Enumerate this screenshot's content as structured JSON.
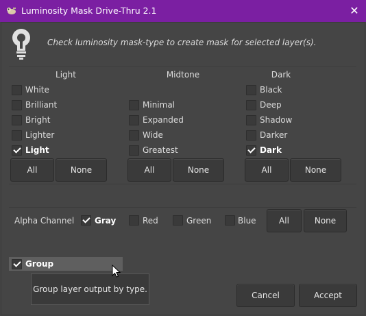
{
  "window": {
    "title": "Luminosity Mask Drive-Thru 2.1",
    "close_glyph": "✕",
    "app_icon": "gimp-wilber-icon"
  },
  "header": {
    "icon": "lightbulb-icon",
    "info_text": "Check luminosity mask-type to create mask for selected layer(s)."
  },
  "columns": {
    "light": {
      "heading": "Light",
      "items": [
        {
          "label": "White",
          "checked": false
        },
        {
          "label": "Brilliant",
          "checked": false
        },
        {
          "label": "Bright",
          "checked": false
        },
        {
          "label": "Lighter",
          "checked": false
        },
        {
          "label": "Light",
          "checked": true
        }
      ],
      "all_label": "All",
      "none_label": "None"
    },
    "midtone": {
      "heading": "Midtone",
      "items": [
        {
          "label": "Minimal",
          "checked": false
        },
        {
          "label": "Expanded",
          "checked": false
        },
        {
          "label": "Wide",
          "checked": false
        },
        {
          "label": "Greatest",
          "checked": false
        }
      ],
      "all_label": "All",
      "none_label": "None"
    },
    "dark": {
      "heading": "Dark",
      "items": [
        {
          "label": "Black",
          "checked": false
        },
        {
          "label": "Deep",
          "checked": false
        },
        {
          "label": "Shadow",
          "checked": false
        },
        {
          "label": "Darker",
          "checked": false
        },
        {
          "label": "Dark",
          "checked": true
        }
      ],
      "all_label": "All",
      "none_label": "None"
    }
  },
  "alpha": {
    "label": "Alpha Channel",
    "items": [
      {
        "label": "Gray",
        "checked": true
      },
      {
        "label": "Red",
        "checked": false
      },
      {
        "label": "Green",
        "checked": false
      },
      {
        "label": "Blue",
        "checked": false
      }
    ],
    "all_label": "All",
    "none_label": "None"
  },
  "group": {
    "label": "Group",
    "checked": true,
    "tooltip": "Group layer output by type."
  },
  "footer": {
    "cancel_label": "Cancel",
    "accept_label": "Accept"
  },
  "colors": {
    "titlebar": "#7b1fa2",
    "background": "#454545",
    "button": "#3a3a3a"
  }
}
